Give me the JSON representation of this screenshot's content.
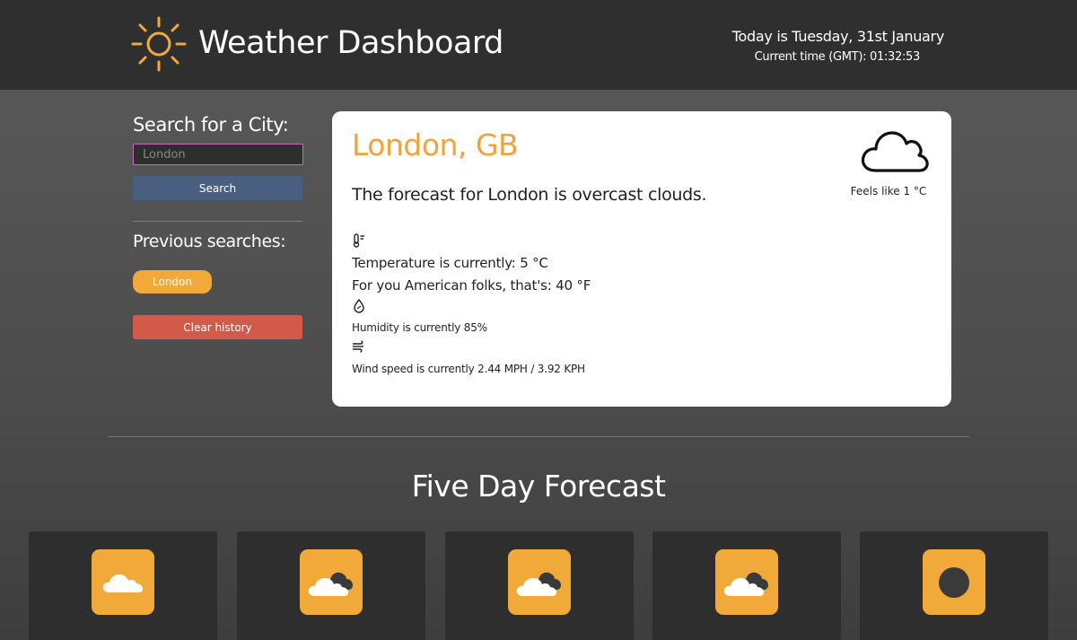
{
  "header": {
    "title": "Weather Dashboard",
    "date_text": "Today is Tuesday, 31st January",
    "time_text": "Current time (GMT): 01:32:53",
    "logo_icon": "sun-icon"
  },
  "sidebar": {
    "search_heading": "Search for a City:",
    "search_input_value": "",
    "search_placeholder": "London",
    "search_button": "Search",
    "previous_heading": "Previous searches:",
    "history": [
      "London"
    ],
    "clear_button": "Clear history"
  },
  "current": {
    "city": "London, GB",
    "description": "The forecast for London is overcast clouds.",
    "condition_icon": "cloud-outline-icon",
    "feels_like": "Feels like 1 °C",
    "temperature_c": "Temperature is currently: 5 °C",
    "temperature_f": "For you American folks, that's: 40 °F",
    "humidity": "Humidity is currently 85%",
    "wind": "Wind speed is currently 2.44 MPH / 3.92 KPH"
  },
  "five_day": {
    "title": "Five Day Forecast",
    "days": [
      {
        "icon": "cloud-icon"
      },
      {
        "icon": "broken-clouds-icon"
      },
      {
        "icon": "broken-clouds-icon"
      },
      {
        "icon": "broken-clouds-icon"
      },
      {
        "icon": "dark-circle-icon"
      }
    ]
  },
  "colors": {
    "accent": "#f1aa3a",
    "header_bg": "#2f2f2f",
    "search_button": "#4a5f80",
    "clear_button": "#d35a49",
    "card_bg": "#ffffff"
  }
}
